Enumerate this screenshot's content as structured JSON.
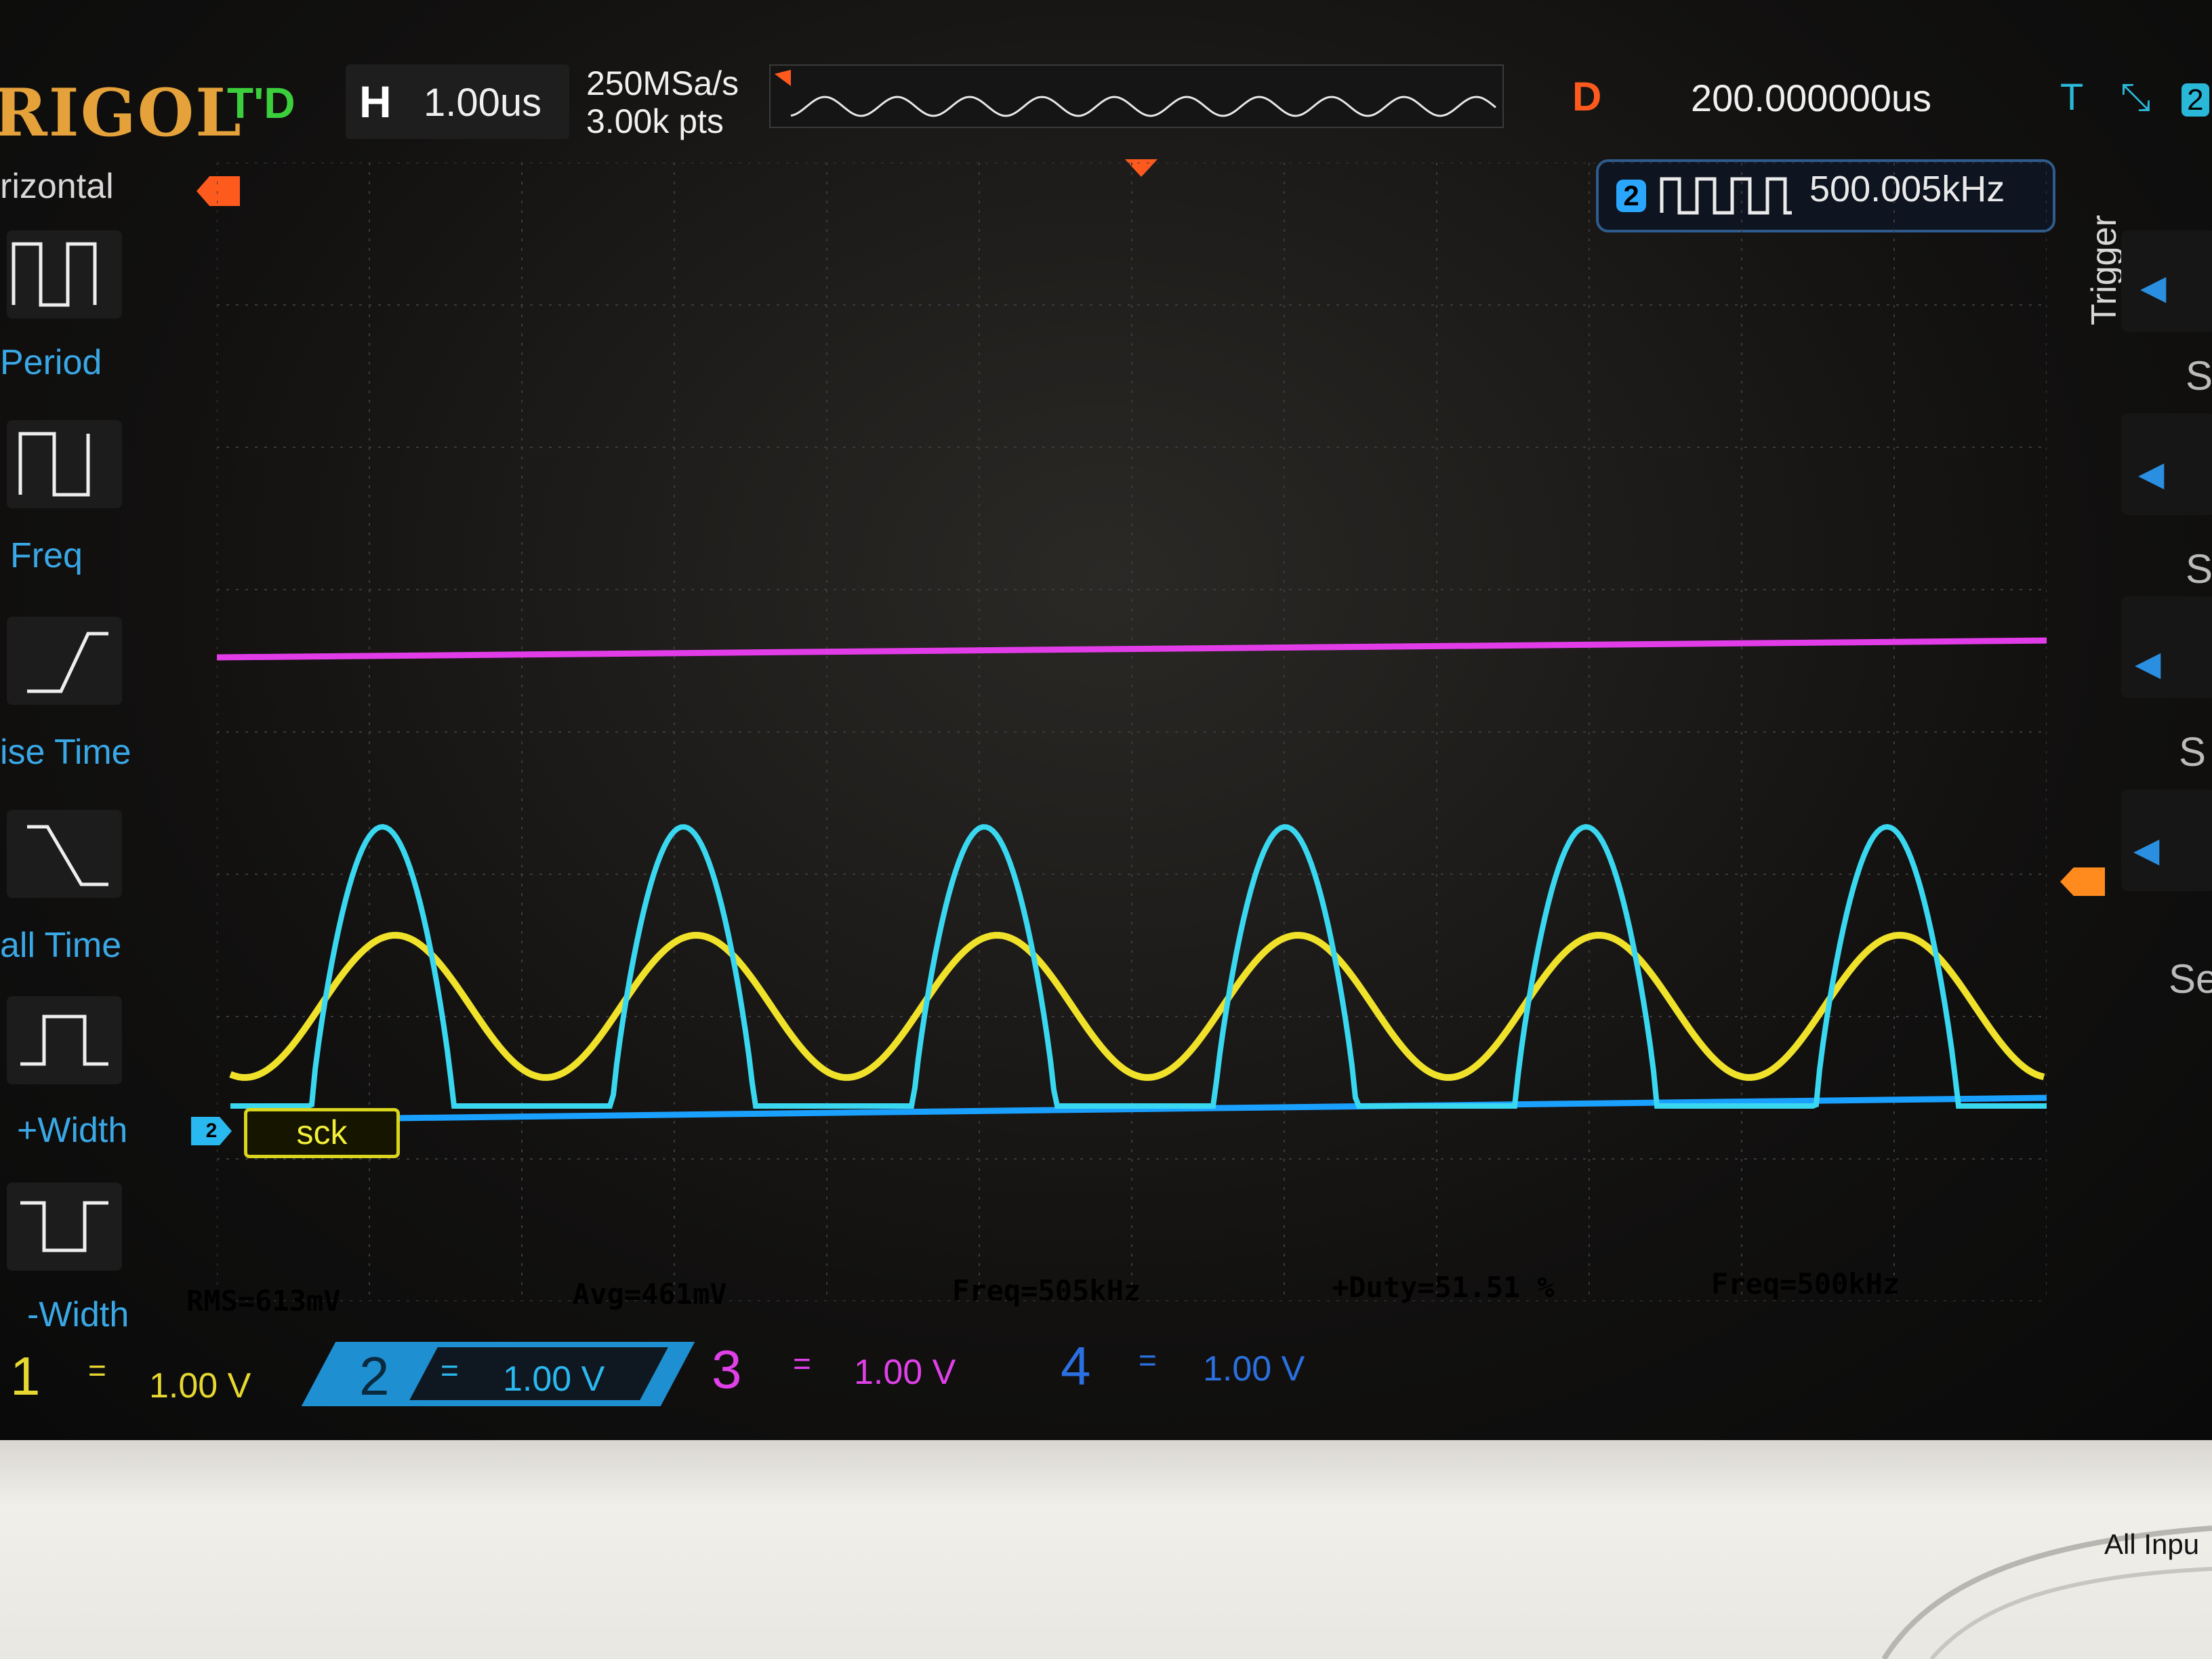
{
  "header": {
    "brand": "RIGOL",
    "status": "T'D",
    "h_label": "H",
    "timebase": "1.00us",
    "sample_rate": "250MSa/s",
    "memory_depth": "3.00k pts",
    "delay_label": "D",
    "delay_value": "200.000000us",
    "trigger_source_badge": "2"
  },
  "freq_counter": {
    "channel": "2",
    "value": "500.005kHz"
  },
  "left_menu": {
    "title": "rizontal",
    "items": [
      {
        "label": "Period"
      },
      {
        "label": "Freq"
      },
      {
        "label": "ise Time"
      },
      {
        "label": "all Time"
      },
      {
        "label": "+Width"
      },
      {
        "label": "-Width"
      }
    ]
  },
  "right_menu": {
    "title": "Trigger",
    "items": [
      "S",
      "S",
      "S",
      "Se"
    ]
  },
  "labels": {
    "sck": "sck",
    "ch2_marker": "2"
  },
  "measurements": [
    {
      "text": "RMS=613mV",
      "color": "#e6d830"
    },
    {
      "text": "Avg=461mV",
      "color": "#e6d830"
    },
    {
      "text": "Freq=505kHz",
      "color": "#e6d830"
    },
    {
      "text": "+Duty=51.51 %",
      "color": "#e6d830"
    },
    {
      "text": "Freq=500kHz",
      "color": "#2ab8f0"
    }
  ],
  "channels": [
    {
      "num": "1",
      "coupling": "=",
      "scale": "1.00 V",
      "color": "#e6d830"
    },
    {
      "num": "2",
      "coupling": "=",
      "scale": "1.00 V",
      "color": "#2ab8f0"
    },
    {
      "num": "3",
      "coupling": "=",
      "scale": "1.00 V",
      "color": "#e040e8"
    },
    {
      "num": "4",
      "coupling": "=",
      "scale": "1.00 V",
      "color": "#2a70e0"
    }
  ],
  "panel": {
    "all_input": "All Inpu"
  },
  "colors": {
    "ch1": "#f0e22a",
    "ch2": "#3ad8f0",
    "ch3": "#e23ce8",
    "ch4": "#1aa0ff",
    "grid": "#3a3a40",
    "trigger": "#ff5a1e"
  }
}
